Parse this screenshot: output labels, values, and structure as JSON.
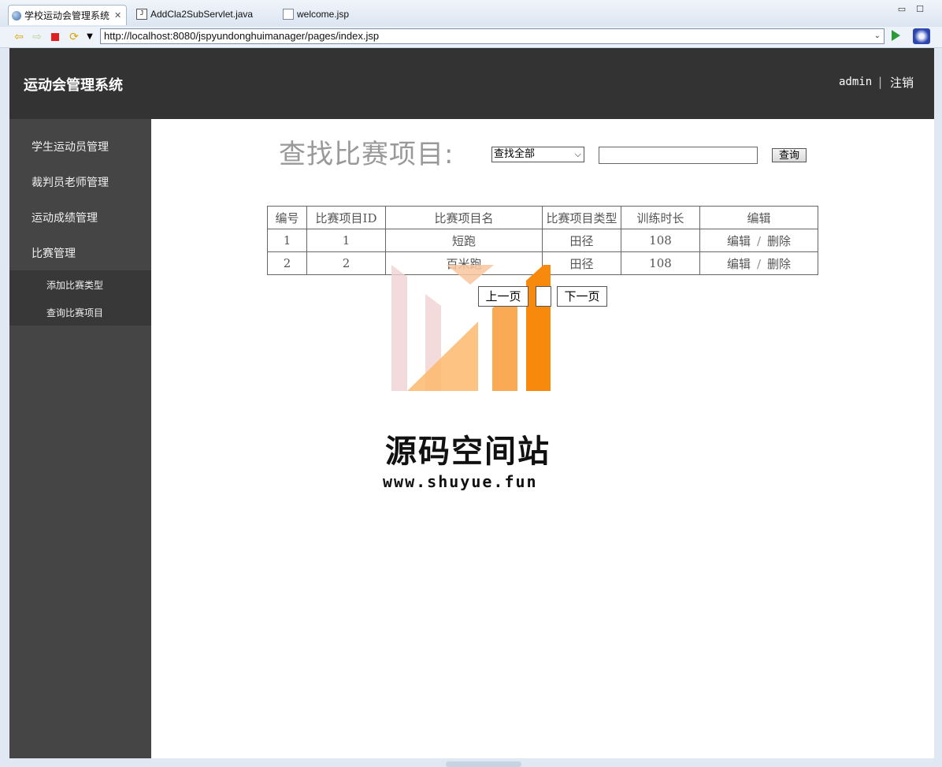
{
  "browser": {
    "tabs": [
      {
        "label": "学校运动会管理系统",
        "active": true,
        "icon": "globe-icon"
      },
      {
        "label": "AddCla2SubServlet.java",
        "active": false,
        "icon": "java-file-icon"
      },
      {
        "label": "welcome.jsp",
        "active": false,
        "icon": "jsp-file-icon"
      }
    ],
    "url": "http://localhost:8080/jspyundonghuimanager/pages/index.jsp"
  },
  "header": {
    "title": "运动会管理系统",
    "user": "admin",
    "separator": "|",
    "logout": "注销"
  },
  "sidebar": {
    "items": [
      {
        "label": "学生运动员管理"
      },
      {
        "label": "裁判员老师管理"
      },
      {
        "label": "运动成绩管理"
      },
      {
        "label": "比赛管理"
      }
    ],
    "subitems": [
      {
        "label": "添加比赛类型"
      },
      {
        "label": "查询比赛项目"
      }
    ]
  },
  "main": {
    "heading": "查找比赛项目:",
    "filter_selected": "查找全部",
    "search_value": "",
    "search_button": "查询",
    "table": {
      "headers": [
        "编号",
        "比赛项目ID",
        "比赛项目名",
        "比赛项目类型",
        "训练时长",
        "编辑"
      ],
      "rows": [
        {
          "num": "1",
          "id": "1",
          "name": "短跑",
          "type": "田径",
          "hours": "108",
          "edit": "编辑",
          "sep": "/",
          "delete": "删除"
        },
        {
          "num": "2",
          "id": "2",
          "name": "百米跑",
          "type": "田径",
          "hours": "108",
          "edit": "编辑",
          "sep": "/",
          "delete": "删除"
        }
      ]
    },
    "pager": {
      "prev": "上一页",
      "next": "下一页"
    }
  },
  "watermark": {
    "title": "源码空间站",
    "url": "www.shuyue.fun"
  },
  "colors": {
    "header_bg": "#333333",
    "sidebar_bg": "#454545",
    "subnav_bg": "#383838",
    "watermark_orange": "#f7890d"
  }
}
